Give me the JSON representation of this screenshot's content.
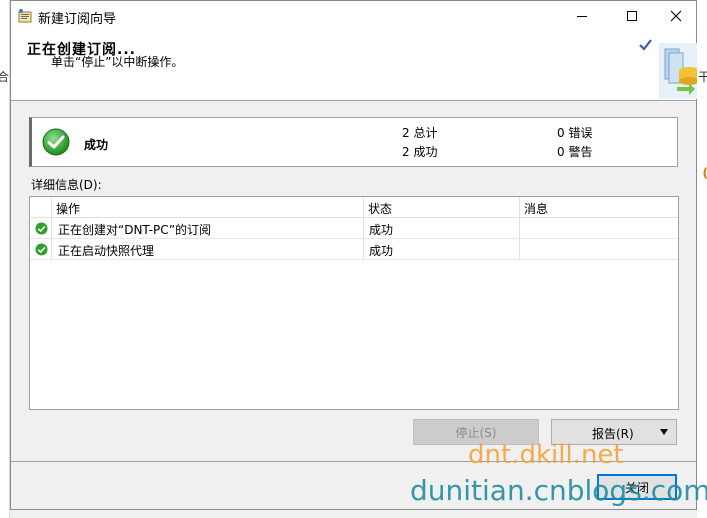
{
  "background": {
    "left_text": "合",
    "right_text": "干",
    "right_char": "("
  },
  "window": {
    "title": "新建订阅向导",
    "header_title": "正在创建订阅...",
    "header_subtitle": "单击“停止”以中断操作。"
  },
  "summary": {
    "status": "成功",
    "total_label": "2 总计",
    "success_label": "2 成功",
    "error_label": "0 错误",
    "warning_label": "0 警告"
  },
  "details": {
    "label": "详细信息(D):",
    "columns": [
      "操作",
      "状态",
      "消息"
    ],
    "rows": [
      {
        "action": "正在创建对“DNT-PC”的订阅",
        "status": "成功",
        "message": ""
      },
      {
        "action": "正在启动快照代理",
        "status": "成功",
        "message": ""
      }
    ]
  },
  "buttons": {
    "stop": "停止(S)",
    "report": "报告(R)",
    "close": "关闭"
  },
  "watermark": {
    "line1": "dnt.dkill.net",
    "line2": "dunitian.cnblogs.com"
  },
  "colors": {
    "success_green": "#2e9e2e",
    "focus_blue": "#0078d7",
    "watermark_orange": "#f2a53a",
    "watermark_teal": "#1f8e9e"
  }
}
